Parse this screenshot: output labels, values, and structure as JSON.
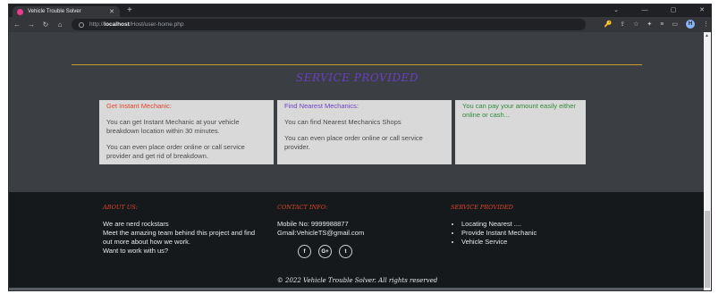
{
  "browser": {
    "tab_title": "Vehicle Trouble Solver",
    "tab_close": "✕",
    "new_tab": "+",
    "window_controls": [
      "⌄",
      "—",
      "▢",
      "✕"
    ],
    "nav": {
      "back": "←",
      "forward": "→",
      "reload": "↻",
      "home": "⌂"
    },
    "url": {
      "scheme": "http://",
      "host": "localhost",
      "path": "/Host/user-home.php"
    },
    "toolbar_icons": [
      "🔑",
      "⇪",
      "☆",
      "✦",
      "≡",
      "▭"
    ],
    "profile_initial": "H"
  },
  "section": {
    "title": "SERVICE PROVIDED"
  },
  "cards": [
    {
      "title": "Get Instant Mechanic:",
      "paragraphs": [
        "You can get Instant Mechanic at your vehicle breakdown location within 30 minutes.",
        "You can even place order online or call service provider and get rid of breakdown."
      ]
    },
    {
      "title": "Find Nearest Mechanics:",
      "paragraphs": [
        "You can find Nearest Mechanics Shops",
        "You can even place order online or call service provider."
      ]
    },
    {
      "title": "You can pay your amount easily either online or cash..."
    }
  ],
  "footer": {
    "about": {
      "heading": "ABOUT US:",
      "lines": [
        "We are nerd rockstars",
        "Meet the amazing team behind this project and find out more about how we work.",
        "Want to work with us?"
      ]
    },
    "contact": {
      "heading": "CONTACT INFO:",
      "mobile": "Mobile No: 9999988877",
      "email": "Gmail:VehicleTS@gmail.com",
      "socials": [
        "f",
        "G+",
        "t"
      ]
    },
    "services": {
      "heading": "SERVICE PROVIDED",
      "items": [
        "Locating Nearest ....",
        "Provide Instant Mechanic",
        "Vehicle Service"
      ]
    },
    "copyright": "© 2022 Vehicle Trouble Solver. All rights reserved"
  }
}
